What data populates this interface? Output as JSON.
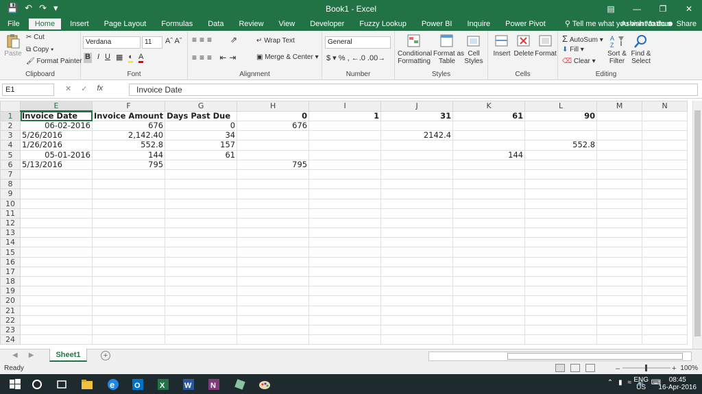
{
  "window": {
    "title": "Book1 - Excel"
  },
  "ribbon_tabs": [
    "File",
    "Home",
    "Insert",
    "Page Layout",
    "Formulas",
    "Data",
    "Review",
    "View",
    "Developer",
    "Fuzzy Lookup",
    "Power BI",
    "Inquire",
    "Power Pivot"
  ],
  "tell_me": "Tell me what you want to do...",
  "user": "Ashish Mathur",
  "share": "Share",
  "clipboard": {
    "paste": "Paste",
    "cut": "Cut",
    "copy": "Copy",
    "format_painter": "Format Painter",
    "label": "Clipboard"
  },
  "font": {
    "name": "Verdana",
    "size": "11",
    "bold": "B",
    "italic": "I",
    "underline": "U",
    "label": "Font"
  },
  "alignment": {
    "wrap": "Wrap Text",
    "merge": "Merge & Center",
    "label": "Alignment"
  },
  "number": {
    "format": "General",
    "label": "Number"
  },
  "styles": {
    "conditional": "Conditional\nFormatting",
    "format_table": "Format as\nTable",
    "cell_styles": "Cell\nStyles",
    "label": "Styles"
  },
  "cells": {
    "insert": "Insert",
    "delete": "Delete",
    "format": "Format",
    "label": "Cells"
  },
  "editing": {
    "autosum": "AutoSum",
    "fill": "Fill",
    "clear": "Clear",
    "sort": "Sort &\nFilter",
    "find": "Find &\nSelect",
    "label": "Editing"
  },
  "formula_bar": {
    "name_box": "E1",
    "content": "Invoice Date"
  },
  "columns": [
    "E",
    "F",
    "G",
    "H",
    "I",
    "J",
    "K",
    "L",
    "M",
    "N"
  ],
  "rows": [
    {
      "n": "1",
      "cells": [
        {
          "v": "Invoice Date",
          "b": true
        },
        {
          "v": "Invoice Amount",
          "b": true
        },
        {
          "v": "Days Past Due",
          "b": true
        },
        {
          "v": "0",
          "b": true,
          "r": true
        },
        {
          "v": "1",
          "b": true,
          "r": true
        },
        {
          "v": "31",
          "b": true,
          "r": true
        },
        {
          "v": "61",
          "b": true,
          "r": true
        },
        {
          "v": "90",
          "b": true,
          "r": true
        },
        {
          "v": ""
        },
        {
          "v": ""
        }
      ]
    },
    {
      "n": "2",
      "cells": [
        {
          "v": "06-02-2016",
          "r": true
        },
        {
          "v": "676",
          "r": true
        },
        {
          "v": "0",
          "r": true
        },
        {
          "v": "676",
          "r": true
        },
        {
          "v": ""
        },
        {
          "v": ""
        },
        {
          "v": ""
        },
        {
          "v": ""
        },
        {
          "v": ""
        },
        {
          "v": ""
        }
      ]
    },
    {
      "n": "3",
      "cells": [
        {
          "v": "5/26/2016"
        },
        {
          "v": "2,142.40",
          "r": true
        },
        {
          "v": "34",
          "r": true
        },
        {
          "v": ""
        },
        {
          "v": ""
        },
        {
          "v": "2142.4",
          "r": true
        },
        {
          "v": ""
        },
        {
          "v": ""
        },
        {
          "v": ""
        },
        {
          "v": ""
        }
      ]
    },
    {
      "n": "4",
      "cells": [
        {
          "v": "1/26/2016"
        },
        {
          "v": "552.8",
          "r": true
        },
        {
          "v": "157",
          "r": true
        },
        {
          "v": ""
        },
        {
          "v": ""
        },
        {
          "v": ""
        },
        {
          "v": ""
        },
        {
          "v": "552.8",
          "r": true
        },
        {
          "v": ""
        },
        {
          "v": ""
        }
      ]
    },
    {
      "n": "5",
      "cells": [
        {
          "v": "05-01-2016",
          "r": true
        },
        {
          "v": "144",
          "r": true
        },
        {
          "v": "61",
          "r": true
        },
        {
          "v": ""
        },
        {
          "v": ""
        },
        {
          "v": ""
        },
        {
          "v": "144",
          "r": true
        },
        {
          "v": ""
        },
        {
          "v": ""
        },
        {
          "v": ""
        }
      ]
    },
    {
      "n": "6",
      "cells": [
        {
          "v": "5/13/2016"
        },
        {
          "v": "795",
          "r": true
        },
        {
          "v": ""
        },
        {
          "v": "795",
          "r": true
        },
        {
          "v": ""
        },
        {
          "v": ""
        },
        {
          "v": ""
        },
        {
          "v": ""
        },
        {
          "v": ""
        },
        {
          "v": ""
        }
      ]
    },
    {
      "n": "7",
      "cells": []
    },
    {
      "n": "8",
      "cells": []
    },
    {
      "n": "9",
      "cells": []
    },
    {
      "n": "10",
      "cells": []
    },
    {
      "n": "11",
      "cells": []
    },
    {
      "n": "12",
      "cells": []
    },
    {
      "n": "13",
      "cells": []
    },
    {
      "n": "14",
      "cells": []
    },
    {
      "n": "15",
      "cells": []
    },
    {
      "n": "16",
      "cells": []
    },
    {
      "n": "17",
      "cells": []
    },
    {
      "n": "18",
      "cells": []
    },
    {
      "n": "19",
      "cells": []
    },
    {
      "n": "20",
      "cells": []
    },
    {
      "n": "21",
      "cells": []
    },
    {
      "n": "22",
      "cells": []
    },
    {
      "n": "23",
      "cells": []
    },
    {
      "n": "24",
      "cells": []
    }
  ],
  "sheet_tab": "Sheet1",
  "status": {
    "ready": "Ready",
    "zoom": "100%"
  },
  "taskbar": {
    "lang1": "ENG",
    "lang2": "US",
    "time": "08:45",
    "date": "16-Apr-2016"
  },
  "colors": {
    "accent": "#217346"
  }
}
